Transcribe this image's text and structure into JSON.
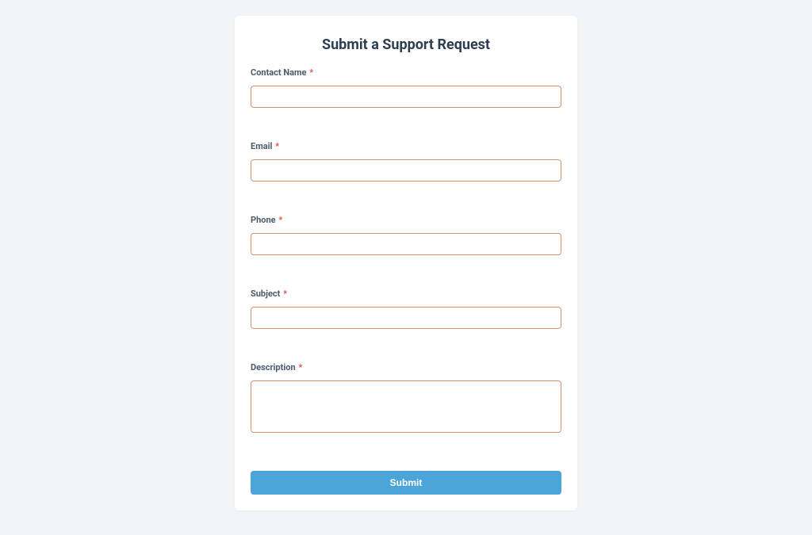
{
  "form": {
    "title": "Submit a Support Request",
    "fields": {
      "contact_name": {
        "label": "Contact Name",
        "required": "*",
        "value": ""
      },
      "email": {
        "label": "Email",
        "required": "*",
        "value": ""
      },
      "phone": {
        "label": "Phone",
        "required": "*",
        "value": ""
      },
      "subject": {
        "label": "Subject",
        "required": "*",
        "value": ""
      },
      "description": {
        "label": "Description",
        "required": "*",
        "value": ""
      }
    },
    "submit_label": "Submit"
  }
}
